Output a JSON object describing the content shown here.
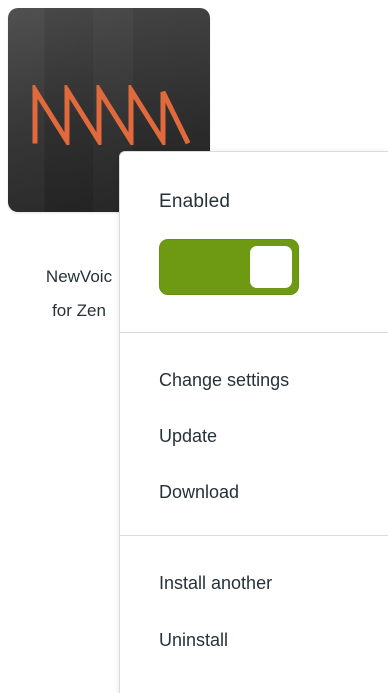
{
  "app": {
    "name_lines": [
      "NewVoic",
      "for Zen"
    ],
    "logo_icon": "waveform-logo-icon",
    "accent_color": "#e06a3c"
  },
  "menu": {
    "status_label": "Enabled",
    "enabled": true,
    "toggle_color": "#6d9a12",
    "items": [
      "Change settings",
      "Update",
      "Download",
      "Install another",
      "Uninstall"
    ]
  }
}
